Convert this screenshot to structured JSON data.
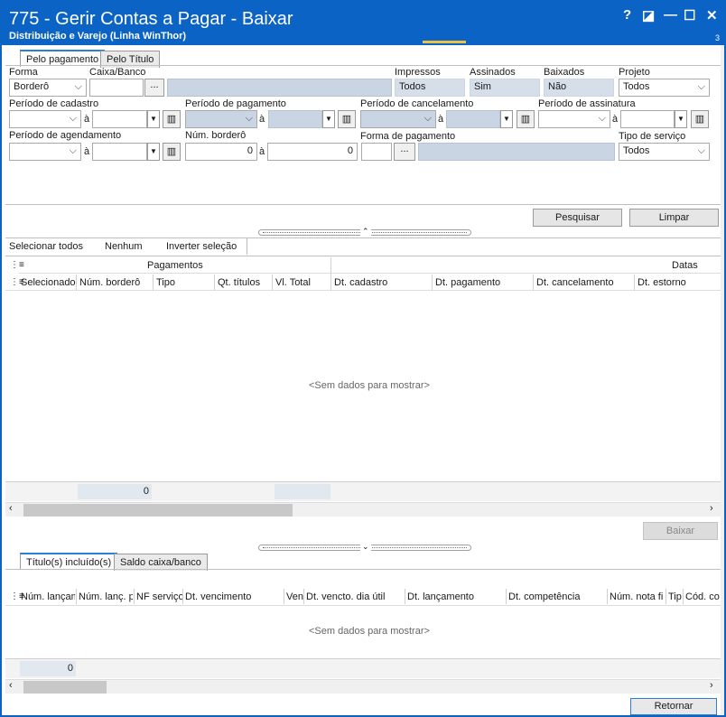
{
  "window": {
    "title": "775 - Gerir Contas a Pagar - Baixar",
    "subtitle": "Distribuição e Varejo (Linha WinThor)",
    "help": "?",
    "resize": "◪",
    "minimize": "—",
    "maximize": "☐",
    "close": "✕",
    "corner_mark": "3"
  },
  "tabs": {
    "pagamento": "Pelo pagamento",
    "titulo": "Pelo Título"
  },
  "filters": {
    "forma_label": "Forma",
    "forma_value": "Borderô",
    "caixa_label": "Caixa/Banco",
    "caixa_btn": "...",
    "impressos_label": "Impressos",
    "impressos_value": "Todos",
    "assinados_label": "Assinados",
    "assinados_value": "Sim",
    "baixados_label": "Baixados",
    "baixados_value": "Não",
    "projeto_label": "Projeto",
    "projeto_value": "Todos",
    "periodo_cadastro": "Período de cadastro",
    "periodo_pagamento": "Período de pagamento",
    "periodo_cancelamento": "Período de cancelamento",
    "periodo_assinatura": "Período de assinatura",
    "periodo_agendamento": "Período de agendamento",
    "num_bordero_label": "Núm. borderô",
    "num_bordero_de": "0",
    "num_bordero_ate": "0",
    "forma_pagamento_label": "Forma de pagamento",
    "forma_pagamento_btn": "...",
    "tipo_servico_label": "Tipo de serviço",
    "tipo_servico_value": "Todos",
    "a": "à"
  },
  "actions": {
    "pesquisar": "Pesquisar",
    "limpar": "Limpar"
  },
  "selection": {
    "todos": "Selecionar todos",
    "nenhum": "Nenhum",
    "inverter": "Inverter seleção"
  },
  "grid": {
    "group_pagamentos": "Pagamentos",
    "group_datas": "Datas",
    "columns": [
      "Selecionado",
      "Núm. borderô",
      "Tipo",
      "Qt. títulos",
      "Vl. Total",
      "Dt. cadastro",
      "Dt. pagamento",
      "Dt. cancelamento",
      "Dt. estorno"
    ],
    "empty": "<Sem dados para mostrar>",
    "footer_count": "0"
  },
  "baixar": "Baixar",
  "bottom_tabs": {
    "incluidos": "Título(s) incluído(s)",
    "saldo": "Saldo caixa/banco"
  },
  "grid2": {
    "columns": [
      "Núm. lançam",
      "Núm. lanç. p",
      "NF serviço",
      "Dt. vencimento",
      "Ven",
      "Dt. vencto. dia útil",
      "Dt. lançamento",
      "Dt. competência",
      "Núm. nota fi",
      "Tip",
      "Cód. co"
    ],
    "empty": "<Sem dados para mostrar>",
    "footer_count": "0"
  },
  "retornar": "Retornar"
}
